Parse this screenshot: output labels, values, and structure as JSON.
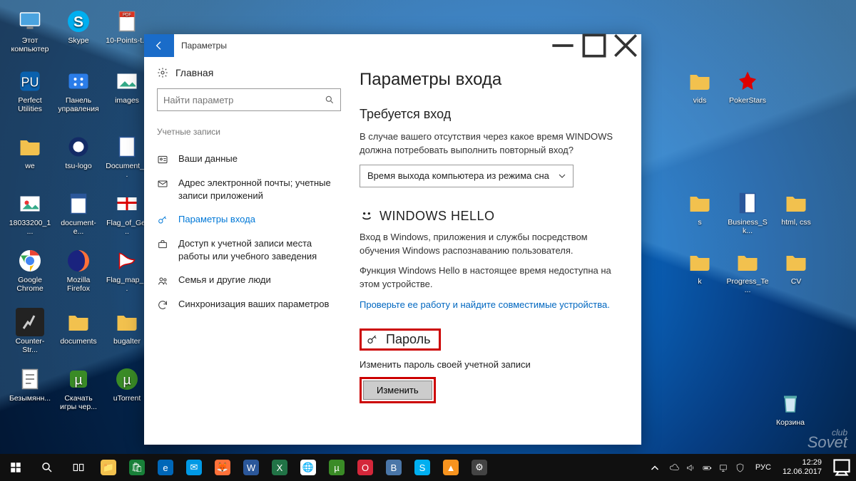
{
  "desktop_icons": {
    "c0": [
      {
        "label": "Этот компьютер",
        "icon": "pc"
      },
      {
        "label": "Perfect Utilities",
        "icon": "app-blue"
      },
      {
        "label": "we",
        "icon": "folder"
      },
      {
        "label": "18033200_1...",
        "icon": "image"
      },
      {
        "label": "Google Chrome",
        "icon": "chrome"
      },
      {
        "label": "Counter-Str...",
        "icon": "cs"
      },
      {
        "label": "Безымянн...",
        "icon": "text"
      }
    ],
    "c1": [
      {
        "label": "Skype",
        "icon": "skype"
      },
      {
        "label": "Панель управления",
        "icon": "cpanel"
      },
      {
        "label": "tsu-logo",
        "icon": "image"
      },
      {
        "label": "document-e...",
        "icon": "doc"
      },
      {
        "label": "Mozilla Firefox",
        "icon": "firefox"
      },
      {
        "label": "documents",
        "icon": "folder"
      },
      {
        "label": "Скачать игры чер...",
        "icon": "utorrent"
      }
    ],
    "c2": [
      {
        "label": "10-Points-t...",
        "icon": "pdf"
      },
      {
        "label": "images",
        "icon": "image"
      },
      {
        "label": "Document_...",
        "icon": "doc"
      },
      {
        "label": "Flag_of_Ge...",
        "icon": "flag"
      },
      {
        "label": "Flag_map_...",
        "icon": "flag2"
      },
      {
        "label": "bugalter",
        "icon": "folder"
      },
      {
        "label": "uTorrent",
        "icon": "utorrent"
      }
    ],
    "right_top": [
      {
        "label": "vids",
        "icon": "folder"
      },
      {
        "label": "PokerStars",
        "icon": "poker"
      }
    ],
    "right_row1": [
      {
        "label": "s",
        "icon": "folder"
      },
      {
        "label": "Business_Sk...",
        "icon": "docblue"
      },
      {
        "label": "html, css",
        "icon": "folder"
      }
    ],
    "right_row2": [
      {
        "label": "k",
        "icon": "folder"
      },
      {
        "label": "Progress_Te...",
        "icon": "folder"
      },
      {
        "label": "CV",
        "icon": "folder"
      }
    ],
    "trash": {
      "label": "Корзина",
      "icon": "trash"
    }
  },
  "window": {
    "title": "Параметры",
    "home": "Главная",
    "search_placeholder": "Найти параметр",
    "category": "Учетные записи",
    "nav": [
      "Ваши данные",
      "Адрес электронной почты; учетные записи приложений",
      "Параметры входа",
      "Доступ к учетной записи места работы или учебного заведения",
      "Семья и другие люди",
      "Синхронизация ваших параметров"
    ],
    "h1": "Параметры входа",
    "req_heading": "Требуется вход",
    "req_desc": "В случае вашего отсутствия через какое время WINDOWS должна потребовать выполнить повторный вход?",
    "req_value": "Время выхода компьютера из режима сна",
    "hello_heading": "WINDOWS HELLO",
    "hello_desc1": "Вход в Windows, приложения и службы посредством обучения Windows распознаванию пользователя.",
    "hello_desc2": "Функция Windows Hello в настоящее время недоступна на этом устройстве.",
    "hello_link": "Проверьте ее работу и найдите совместимые устройства.",
    "pw_heading": "Пароль",
    "pw_desc": "Изменить пароль своей учетной записи",
    "pw_button": "Изменить"
  },
  "taskbar": {
    "lang": "РУС",
    "time": "12:29",
    "date": "12.06.2017"
  },
  "watermark": {
    "top": "club",
    "bottom": "Sovet"
  }
}
